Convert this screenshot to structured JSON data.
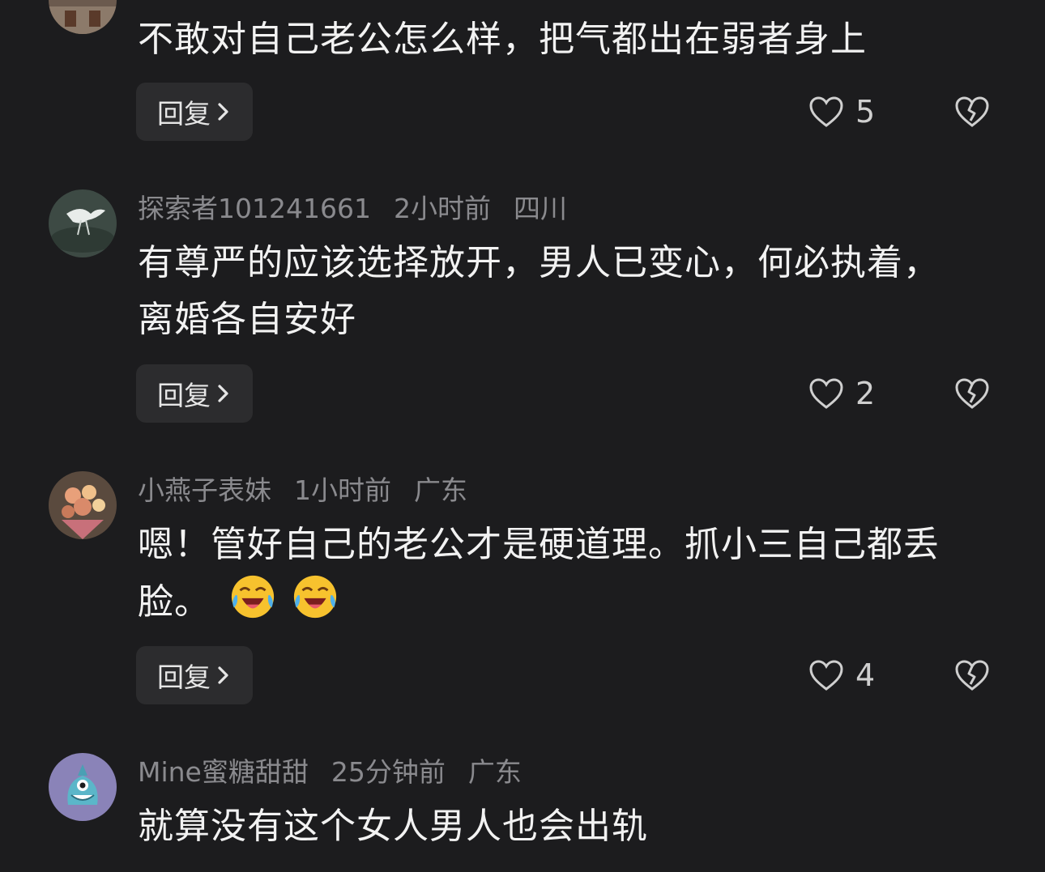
{
  "icons": {
    "like": "heart-outline-icon",
    "dislike": "broken-heart-icon",
    "chevron": "chevron-right-icon",
    "emoji": "laughing-crying-emoji"
  },
  "colors": {
    "background": "#1c1c1e",
    "button_bg": "#2c2c2e",
    "meta_text": "#8a8a8e"
  },
  "comments": [
    {
      "username": "",
      "time": "",
      "location": "",
      "text": "不敢对自己老公怎么样，把气都出在弱者身上",
      "text_line2": "",
      "reply_label": "回复",
      "likes": "5"
    },
    {
      "username": "探索者101241661",
      "time": "2小时前",
      "location": "四川",
      "text": "有尊严的应该选择放开，男人已变心，何必执着，",
      "text_line2": "离婚各自安好",
      "reply_label": "回复",
      "likes": "2"
    },
    {
      "username": "小燕子表妹",
      "time": "1小时前",
      "location": "广东",
      "text": "嗯！管好自己的老公才是硬道理。抓小三自己都丢",
      "text_line2": "脸。",
      "reply_label": "回复",
      "likes": "4"
    },
    {
      "username": "Mine蜜糖甜甜",
      "time": "25分钟前",
      "location": "广东",
      "text": "就算没有这个女人男人也会出轨",
      "text_line2": "",
      "reply_label": "",
      "likes": ""
    }
  ]
}
